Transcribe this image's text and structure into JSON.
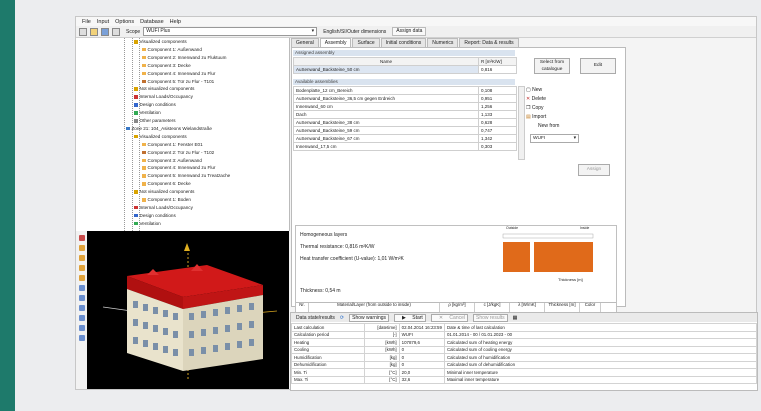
{
  "menu": [
    "File",
    "Input",
    "Options",
    "Database",
    "Help"
  ],
  "toolbar": {
    "scope_label": "Scope",
    "scope_value": "WUFI Plus",
    "dims_label": "English/SI/Outer dimensions",
    "assign_label": "Assign data"
  },
  "tree": [
    {
      "t": "Visualized components",
      "c": "#d9a300",
      "x": 58
    },
    {
      "t": "Component 1: Außenwand",
      "c": "#f0b24a",
      "x": 66
    },
    {
      "t": "Component 2: Innenwand zu Fluktuum",
      "c": "#f0b24a",
      "x": 66
    },
    {
      "t": "Component 3: Decke",
      "c": "#f0b24a",
      "x": 66
    },
    {
      "t": "Component 4: Innenwand zu Flur",
      "c": "#f0b24a",
      "x": 66
    },
    {
      "t": "Component 5: Tür zu Flur - T101",
      "c": "#c07030",
      "x": 66
    },
    {
      "t": "Not visualized components",
      "c": "#d9a300",
      "x": 58
    },
    {
      "t": "Internal Loads/Occupancy",
      "c": "#cc3333",
      "x": 58
    },
    {
      "t": "Design conditions",
      "c": "#3366cc",
      "x": 58
    },
    {
      "t": "Ventilation",
      "c": "#33aa55",
      "x": 58
    },
    {
      "t": "Other parameters",
      "c": "#888888",
      "x": 58
    },
    {
      "t": "Zone 21: 104_Asisteons Wielandstraße",
      "c": "#3a79c7",
      "x": 50
    },
    {
      "t": "Visualized components",
      "c": "#d9a300",
      "x": 58
    },
    {
      "t": "Component 1: Fenster E01",
      "c": "#f0b24a",
      "x": 66
    },
    {
      "t": "Component 2: Tür zu Flur - T102",
      "c": "#c07030",
      "x": 66
    },
    {
      "t": "Component 3: Außenwand",
      "c": "#f0b24a",
      "x": 66
    },
    {
      "t": "Component 4: Innenwand zu Flur",
      "c": "#f0b24a",
      "x": 66
    },
    {
      "t": "Component 5: Innenwand zu Treatzache",
      "c": "#f0b24a",
      "x": 66
    },
    {
      "t": "Component 6: Decke",
      "c": "#f0b24a",
      "x": 66
    },
    {
      "t": "Not visualized components",
      "c": "#d9a300",
      "x": 58
    },
    {
      "t": "Component 1: Boden",
      "c": "#f0b24a",
      "x": 66
    },
    {
      "t": "Internal Loads/Occupancy",
      "c": "#cc3333",
      "x": 58
    },
    {
      "t": "Design conditions",
      "c": "#3366cc",
      "x": 58
    },
    {
      "t": "Ventilation",
      "c": "#33aa55",
      "x": 58
    }
  ],
  "tabs": [
    "General",
    "Assembly",
    "Surface",
    "Initial conditions",
    "Numerics",
    "Report: Data & results"
  ],
  "assigned": {
    "header": "Assigned assembly",
    "col_name": "Name",
    "col_r": "R [m²K/W]",
    "name": "AuSenwand_Backsteine_50 cm",
    "r": "0,816"
  },
  "buttons": {
    "select": "Select from catalogue",
    "edit": "Edit",
    "assign": "Assign"
  },
  "available": {
    "header": "Available assemblies",
    "rows": [
      {
        "name": "Bodenplatte_12 cm_Bereich",
        "r": "0,108"
      },
      {
        "name": "AuSenwand_Backsteine_36,5 cm gegen Erdreich",
        "r": "0,951"
      },
      {
        "name": "Innenwand_60 cm",
        "r": "1,256"
      },
      {
        "name": "Dach",
        "r": "1,133"
      },
      {
        "name": "AuSenwand_Backsteine_38 cm",
        "r": "0,628"
      },
      {
        "name": "AuSenwand_Backsteine_59 cm",
        "r": "0,747"
      },
      {
        "name": "AuSenwand_Backsteine_67 cm",
        "r": "1,342"
      },
      {
        "name": "Innenwand_17,5 cm",
        "r": "0,303"
      }
    ]
  },
  "actions": {
    "new": "New",
    "delete": "Delete",
    "copy": "Copy",
    "import": "Import",
    "new_from": "New from",
    "new_from_value": "WUFI"
  },
  "layers": {
    "title": "Homogeneous layers",
    "resistance": "Thermal resistance: 0,816 m²K/W",
    "u_value": "Heat transfer coefficient (U-value): 1,01 W/m²K",
    "thickness": "Thickness: 0,54 m",
    "axis": "Thickness [m]",
    "outside": "Outside",
    "inside": "Inside"
  },
  "layer_table": {
    "nr": "Nr.",
    "mat": "Material/Layer (from outside to inside)",
    "rho": "ρ [kg/m³]",
    "c": "c [J/kgK]",
    "lambda": "λ [W/mK]",
    "thick": "Thickness [m]",
    "color": "Color"
  },
  "results": {
    "bar": {
      "title": "Data state/results",
      "warn": "Show warnings",
      "start": "Start",
      "cancel": "Cancel",
      "show": "Show results"
    },
    "rows": [
      {
        "a": "Last calculation",
        "b": "[datetime]",
        "c": "02.04.2014 16:23:59",
        "d": "Date & time of last calculation"
      },
      {
        "a": "Calculation period",
        "b": "[-]",
        "c": "WUFI",
        "d": "01.01.2014 - 00 / 01.01.2023 - 00"
      },
      {
        "a": "Heating",
        "b": "[kWh]",
        "c": "107879,6",
        "d": "Calculated sum of heating energy"
      },
      {
        "a": "Cooling",
        "b": "[kWh]",
        "c": "0",
        "d": "Calculated sum of cooling energy"
      },
      {
        "a": "Humidification",
        "b": "[kg]",
        "c": "0",
        "d": "Calculated sum of humidification"
      },
      {
        "a": "Dehumidification",
        "b": "[kg]",
        "c": "0",
        "d": "Calculated sum of dehumidification"
      },
      {
        "a": "Min. Ti",
        "b": "[°C]",
        "c": "20,0",
        "d": "Minimal inner temperature"
      },
      {
        "a": "Max. Ti",
        "b": "[°C]",
        "c": "32,6",
        "d": "Maximal inner temperature"
      }
    ]
  }
}
